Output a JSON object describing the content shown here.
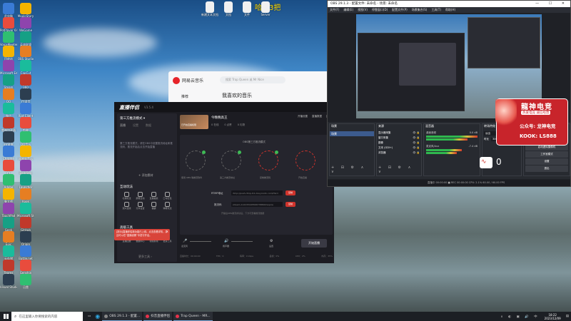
{
  "desktop": {
    "overlay_text": "哈哈3把",
    "icons_left": [
      "此电脑",
      "PotPlayer 64 bit",
      "VoiceMeeter 8 (Banana)",
      "回收站",
      "Microsoft Edge",
      "Steam",
      "QQ",
      "微信",
      "雷神加速器",
      "EV录屏",
      "Chrome",
      "YY",
      "Adobe",
      "鲁大师",
      "TouchPad",
      "Geek",
      "Epic",
      "云存储",
      "Teams",
      "Visual Studio",
      "Trap Queen - MR"
    ],
    "icons_right": [
      "MapleStory",
      "WeGame",
      "英雄联盟",
      "OBS Studio",
      "CapCut",
      "360",
      "YY语音",
      "Riot Client",
      "剪映",
      "QQ音乐",
      "网易云音乐",
      "Bandizip",
      "Launcher",
      "Kook",
      "Microsoft Store",
      "GitHub",
      "Origin",
      "Battle.net",
      "Genshin",
      "迅雷"
    ],
    "top_files": [
      "新建文本文档",
      "文档",
      "文件",
      "Server"
    ]
  },
  "netease": {
    "logo": "网易云音乐",
    "search_placeholder": "搜索 Trap Queen 或 Mr Nice",
    "nav_item": "推荐",
    "heading": "我喜欢的音乐"
  },
  "dj_app": {
    "logo": "直播伴侣",
    "version": "V3.5.4",
    "mode_label": "第三方推流模式 ▾",
    "left_tabs": [
      "直播",
      "设置",
      "数据"
    ],
    "left_desc": "第三方推流模式，请在OBS中设置推流地址和推流码，推流开始后点击开始直播",
    "add_btn": "+ 添加素材",
    "section_interact": "互动玩法",
    "interact_items": [
      "礼物玩法",
      "屏幕互动",
      "直播抽奖",
      "口令红包",
      "观众连线",
      "分享设置",
      "福袋",
      "弹幕玩法"
    ],
    "section_tools": "高级工具",
    "tool_items": [
      "直播回放",
      "数据中心",
      "视频剪辑",
      "更多工具"
    ],
    "more_tools": "更多工具 ›",
    "notice": "[提示]直播伴侣新功能已上线，点击查看详情，并且可以在“直播设置”中进行开启。",
    "header_title": "今晚晚高王",
    "room_tag": "已开启直播权限",
    "header_stats": [
      "0 在线",
      "0 点赞",
      "0 礼物"
    ],
    "header_buttons": [
      "开播设置",
      "直播数据",
      "直播"
    ],
    "flow_title": "OBS第三方推流模式",
    "steps": [
      "使用 OBS 等推流软件",
      "第三方推流地址",
      "复制推流码",
      "开始直播"
    ],
    "rtmp_label": "RTMP地址",
    "rtmp_value": "rtmp://push-rtmp-l11.douyincdn.com/third",
    "key_label": "推流码",
    "key_value": "stream-112233445566778899?expire",
    "copy_btn": "复制",
    "hint": "开播后OBS推流成功后，下方可查看推流数据",
    "bottom_controls": [
      "麦克风",
      "扬声器",
      "设置"
    ],
    "start_btn": "开始直播",
    "footer_stats": [
      "直播时长：00:00:00",
      "FPS：0",
      "码率：0 kbps",
      "丢帧：0%",
      "CPU：2%",
      "内存：35%"
    ]
  },
  "obs": {
    "title": "OBS 29.1.3 - 配置文件: 未命名 - 场景: 未命名",
    "menu": [
      "文件(F)",
      "编辑(E)",
      "视图(V)",
      "停靠窗口(D)",
      "配置文件(P)",
      "场景集合(S)",
      "工具(T)",
      "帮助(H)"
    ],
    "panel_scenes": "场景",
    "scene_item": "场景",
    "panel_sources": "来源",
    "sources": [
      "显示器采集",
      "窗口采集",
      "图像",
      "文本 (GDI+)",
      "浏览器"
    ],
    "panel_mixer": "混音器",
    "mixer_tracks": [
      "桌面音频",
      "麦克风/Aux"
    ],
    "mixer_db": [
      "0.0 dB",
      "-7.4 dB"
    ],
    "panel_transitions": "转场特效",
    "transition_value": "淡出",
    "duration_label": "时长",
    "duration_value": "300 ms",
    "controls_label": "控制按钮",
    "controls": [
      "开始推流",
      "开始录制",
      "启动虚拟摄像机",
      "工作室模式",
      "设置",
      "退出"
    ],
    "status": "直播中 00:00:00  ■ REC 00:00:00  CPU: 2.1%  60.00 / 60.00 FPS"
  },
  "streamer_badge": {
    "name": "龍神电竞",
    "slogan": "热爱电竞 诚信经营",
    "line1": "公众号: 龙神电竞",
    "line2": "KOOK: LS888"
  },
  "tray_widget": {
    "count": "0"
  },
  "taskbar": {
    "search_placeholder": "在这里输入你要搜索的内容",
    "items": [
      "OBS 29.1.3 - 配置...",
      "抖音直播伴侣",
      "Trap Queen - MR..."
    ],
    "time": "18:22",
    "date": "2023/12/09"
  }
}
